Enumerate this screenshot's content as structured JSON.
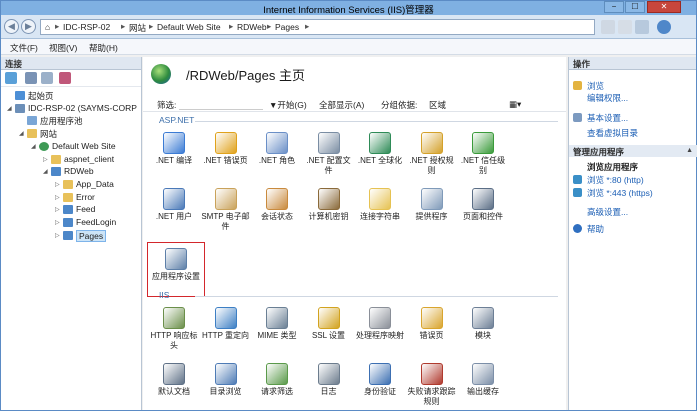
{
  "window": {
    "title": "Internet Information Services (IIS)管理器",
    "buttons": [
      "−",
      "☐",
      "✕"
    ]
  },
  "address": {
    "crumbs": [
      "IDC-RSP-02",
      "网站",
      "Default Web Site",
      "RDWeb",
      "Pages"
    ]
  },
  "menu": [
    "文件(F)",
    "视图(V)",
    "帮助(H)"
  ],
  "connections": {
    "header": "连接",
    "tree": [
      {
        "label": "起始页",
        "level": 0,
        "icon": "home-icon"
      },
      {
        "label": "IDC-RSP-02 (SAYMS-CORP",
        "level": 0,
        "icon": "server-icon",
        "expand": "◢"
      },
      {
        "label": "应用程序池",
        "level": 1,
        "icon": "app-pool-icon"
      },
      {
        "label": "网站",
        "level": 1,
        "icon": "folder-icon",
        "expand": "◢"
      },
      {
        "label": "Default Web Site",
        "level": 2,
        "icon": "globe-icon",
        "expand": "◢"
      },
      {
        "label": "aspnet_client",
        "level": 3,
        "icon": "folder-icon",
        "expand": "▷"
      },
      {
        "label": "RDWeb",
        "level": 3,
        "icon": "app-icon",
        "expand": "◢"
      },
      {
        "label": "App_Data",
        "level": 4,
        "icon": "folder-icon",
        "expand": "▷"
      },
      {
        "label": "Error",
        "level": 4,
        "icon": "folder-icon",
        "expand": "▷"
      },
      {
        "label": "Feed",
        "level": 4,
        "icon": "app-icon",
        "expand": "▷"
      },
      {
        "label": "FeedLogin",
        "level": 4,
        "icon": "app-icon",
        "expand": "▷"
      },
      {
        "label": "Pages",
        "level": 4,
        "icon": "app-icon",
        "expand": "▷",
        "selected": true
      }
    ]
  },
  "main": {
    "title": "/RDWeb/Pages 主页",
    "filter": {
      "label": "筛选:",
      "start": "▼开始(G)",
      "show_all": "全部显示(A)",
      "group_label": "分组依据:",
      "group_value": "区域"
    },
    "sections": [
      {
        "name": "ASP.NET",
        "items": [
          {
            "label": ".NET 编译",
            "icon": "net-compile-icon",
            "color": "#3b7bd4"
          },
          {
            "label": ".NET 错误页",
            "icon": "net-error-page-icon",
            "color": "#e0a21b"
          },
          {
            "label": ".NET 角色",
            "icon": "net-roles-icon",
            "color": "#6a8fc7"
          },
          {
            "label": ".NET 配置文件",
            "icon": "net-profile-icon",
            "color": "#7a8da3"
          },
          {
            "label": ".NET 全球化",
            "icon": "net-globalization-icon",
            "color": "#2e8b57"
          },
          {
            "label": ".NET 授权规则",
            "icon": "net-authorization-icon",
            "color": "#d4a12a"
          },
          {
            "label": ".NET 信任级别",
            "icon": "net-trust-icon",
            "color": "#3a9b3a"
          },
          {
            "label": ".NET 用户",
            "icon": "net-users-icon",
            "color": "#4a79b8"
          },
          {
            "label": "SMTP 电子邮件",
            "icon": "smtp-email-icon",
            "color": "#c9a25a"
          },
          {
            "label": "会话状态",
            "icon": "session-state-icon",
            "color": "#c98a3d"
          },
          {
            "label": "计算机密钥",
            "icon": "machine-key-icon",
            "color": "#8a6a3a"
          },
          {
            "label": "连接字符串",
            "icon": "connection-strings-icon",
            "color": "#e6c252"
          },
          {
            "label": "提供程序",
            "icon": "providers-icon",
            "color": "#7f9ab9"
          },
          {
            "label": "页面和控件",
            "icon": "pages-controls-icon",
            "color": "#5b6e86"
          },
          {
            "label": "应用程序设置",
            "icon": "app-settings-icon",
            "color": "#5d7fa8",
            "selected": true
          }
        ]
      },
      {
        "name": "IIS",
        "items": [
          {
            "label": "HTTP 响应标头",
            "icon": "http-headers-icon",
            "color": "#6b8f4a"
          },
          {
            "label": "HTTP 重定向",
            "icon": "http-redirect-icon",
            "color": "#3d7fc4"
          },
          {
            "label": "MIME 类型",
            "icon": "mime-types-icon",
            "color": "#6a7f94"
          },
          {
            "label": "SSL 设置",
            "icon": "ssl-icon",
            "color": "#d2a31f"
          },
          {
            "label": "处理程序映射",
            "icon": "handler-mappings-icon",
            "color": "#8a8f98"
          },
          {
            "label": "错误页",
            "icon": "error-pages-icon",
            "color": "#d9a52e"
          },
          {
            "label": "模块",
            "icon": "modules-icon",
            "color": "#6d7f96"
          },
          {
            "label": "默认文档",
            "icon": "default-document-icon",
            "color": "#5f7187"
          },
          {
            "label": "目录浏览",
            "icon": "directory-browsing-icon",
            "color": "#4e7bb5"
          },
          {
            "label": "请求筛选",
            "icon": "request-filtering-icon",
            "color": "#5a9a4a"
          },
          {
            "label": "日志",
            "icon": "logging-icon",
            "color": "#6c7c8d"
          },
          {
            "label": "身份验证",
            "icon": "authentication-icon",
            "color": "#3c6fb2"
          },
          {
            "label": "失败请求跟踪规则",
            "icon": "failed-request-icon",
            "color": "#b03a2e"
          },
          {
            "label": "输出缓存",
            "icon": "output-caching-icon",
            "color": "#7c8fa8"
          }
        ]
      }
    ]
  },
  "actions": {
    "header": "操作",
    "top_links": [
      "浏览",
      "编辑权限...",
      "基本设置...",
      "查看虚拟目录"
    ],
    "manage_header": "管理应用程序",
    "browse_sub": "浏览应用程序",
    "browse_links": [
      "浏览 *:80 (http)",
      "浏览 *:443 (https)"
    ],
    "advanced": "高级设置...",
    "help": "帮助"
  }
}
